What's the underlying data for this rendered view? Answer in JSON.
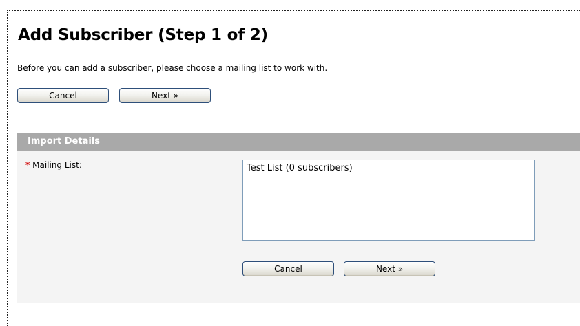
{
  "page": {
    "title": "Add Subscriber (Step 1 of 2)",
    "intro": "Before you can add a subscriber, please choose a mailing list to work with."
  },
  "buttons": {
    "cancel": "Cancel",
    "next": "Next »"
  },
  "panel": {
    "title": "Import Details",
    "required_marker": "*",
    "mailing_list_label": "Mailing List:",
    "mailing_list_options": [
      "Test List (0 subscribers)"
    ]
  },
  "colors": {
    "panel_header": "#a9a9a9",
    "panel_background": "#f4f4f4",
    "required": "#d00000",
    "button_border": "#2e4f7a"
  }
}
